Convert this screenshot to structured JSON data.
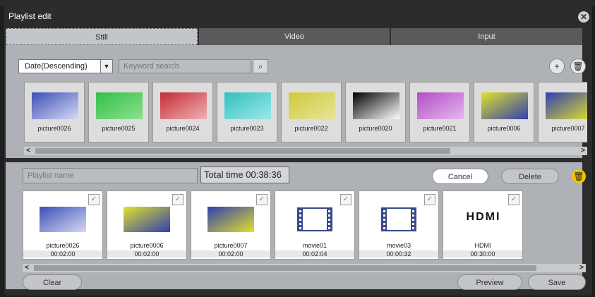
{
  "window": {
    "title": "Playlist edit"
  },
  "tabs": [
    {
      "label": "Still"
    },
    {
      "label": "Video"
    },
    {
      "label": "Input"
    }
  ],
  "toolbar": {
    "sort_value": "Date(Descending)",
    "search_placeholder": "Keyword search"
  },
  "library": [
    {
      "label": "picture0026",
      "colors": [
        "#3b4fb7",
        "#d6d9f2"
      ]
    },
    {
      "label": "picture0025",
      "colors": [
        "#33c046",
        "#8be08f"
      ]
    },
    {
      "label": "picture0024",
      "colors": [
        "#c42b33",
        "#f1b1b4"
      ]
    },
    {
      "label": "picture0023",
      "colors": [
        "#2fc0c0",
        "#9fe8e8"
      ]
    },
    {
      "label": "picture0022",
      "colors": [
        "#cfc93a",
        "#e7e59a"
      ]
    },
    {
      "label": "picture0020",
      "colors": [
        "#000000",
        "#ffffff"
      ]
    },
    {
      "label": "picture0021",
      "colors": [
        "#b24dc4",
        "#e6b6ef"
      ]
    },
    {
      "label": "picture0006",
      "colors": [
        "#e2e12c",
        "#2f3fb0"
      ]
    },
    {
      "label": "picture0007",
      "colors": [
        "#2f3fb0",
        "#e2e12c"
      ]
    }
  ],
  "playlist": {
    "name_placeholder": "Playlist name",
    "total_time": "Total time 00:38:36",
    "cancel_label": "Cancel",
    "delete_label": "Delete",
    "items": [
      {
        "label": "picture0026",
        "time": "00:02:00",
        "kind": "image",
        "colors": [
          "#3b4fb7",
          "#d6d9f2"
        ]
      },
      {
        "label": "picture0006",
        "time": "00:02:00",
        "kind": "image",
        "colors": [
          "#e2e12c",
          "#2f3fb0"
        ]
      },
      {
        "label": "picture0007",
        "time": "00:02:00",
        "kind": "image",
        "colors": [
          "#2f3fb0",
          "#e2e12c"
        ]
      },
      {
        "label": "movie01",
        "time": "00:02:04",
        "kind": "video"
      },
      {
        "label": "movie03",
        "time": "00:00:32",
        "kind": "video"
      },
      {
        "label": "HDMI",
        "time": "00:30:00",
        "kind": "hdmi",
        "logo": "HDMI"
      }
    ]
  },
  "footer": {
    "clear_label": "Clear",
    "preview_label": "Preview",
    "save_label": "Save"
  }
}
